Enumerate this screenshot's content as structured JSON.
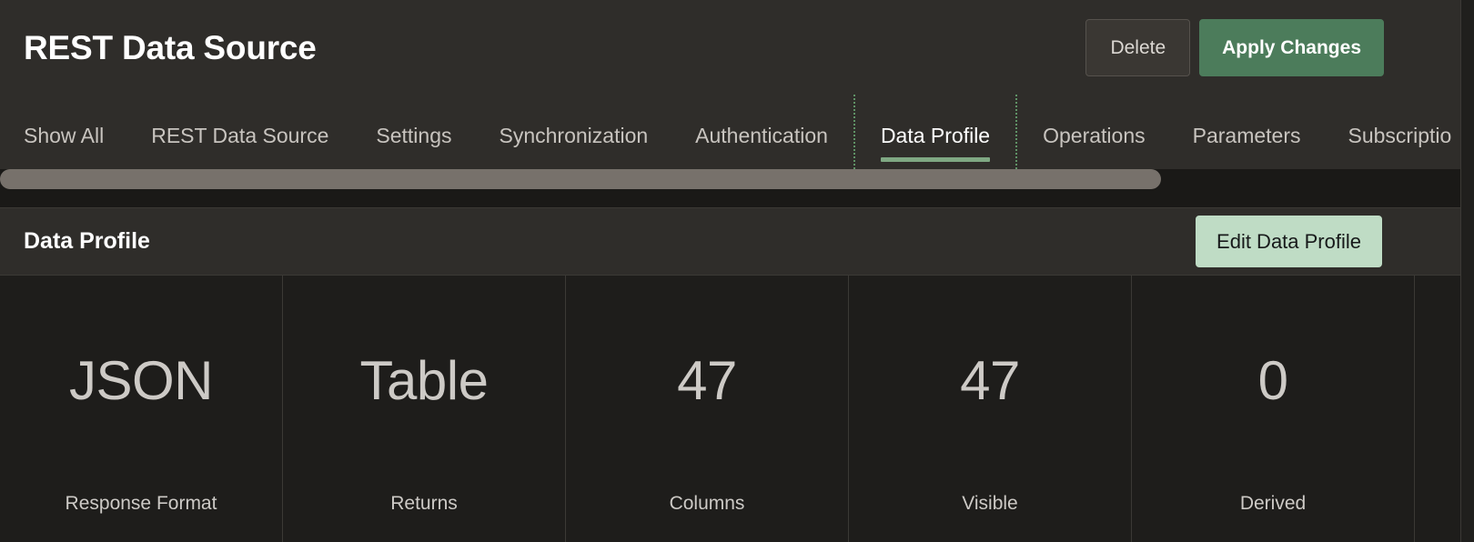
{
  "header": {
    "title": "REST Data Source",
    "delete_label": "Delete",
    "apply_label": "Apply Changes",
    "accent_green": "#4c7c5b"
  },
  "tabs": {
    "items": [
      {
        "label": "Show All",
        "active": false
      },
      {
        "label": "REST Data Source",
        "active": false
      },
      {
        "label": "Settings",
        "active": false
      },
      {
        "label": "Synchronization",
        "active": false
      },
      {
        "label": "Authentication",
        "active": false
      },
      {
        "label": "Data Profile",
        "active": true
      },
      {
        "label": "Operations",
        "active": false
      },
      {
        "label": "Parameters",
        "active": false
      },
      {
        "label": "Subscriptio",
        "active": false
      }
    ],
    "active_underline_color": "#7fa883",
    "separator_color": "#5f9366"
  },
  "scrollbar": {
    "orientation": "horizontal",
    "thumb_color": "#77716b",
    "track_color": "#1a1917"
  },
  "region": {
    "title": "Data Profile",
    "edit_label": "Edit Data Profile",
    "edit_background": "#bfdcc5"
  },
  "cards": [
    {
      "value": "JSON",
      "label": "Response Format"
    },
    {
      "value": "Table",
      "label": "Returns"
    },
    {
      "value": "47",
      "label": "Columns"
    },
    {
      "value": "47",
      "label": "Visible"
    },
    {
      "value": "0",
      "label": "Derived"
    }
  ]
}
